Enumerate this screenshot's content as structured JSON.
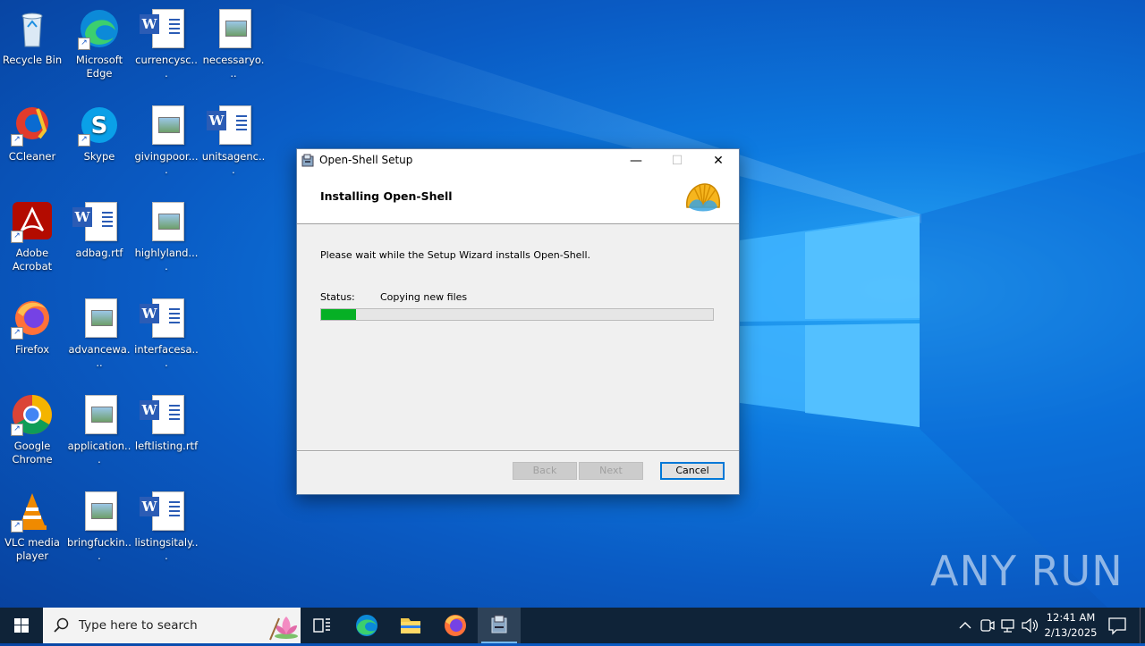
{
  "desktop": {
    "icons": [
      {
        "label": "Recycle Bin"
      },
      {
        "label": "Microsoft Edge"
      },
      {
        "label": "currencysc..."
      },
      {
        "label": "necessaryo..."
      },
      {
        "label": "CCleaner"
      },
      {
        "label": "Skype"
      },
      {
        "label": "givingpoor...."
      },
      {
        "label": "unitsagenc..."
      },
      {
        "label": "Adobe Acrobat"
      },
      {
        "label": "adbag.rtf"
      },
      {
        "label": "highlyland...."
      },
      {
        "label": "Firefox"
      },
      {
        "label": "advancewa..."
      },
      {
        "label": "interfacesa..."
      },
      {
        "label": "Google Chrome"
      },
      {
        "label": "application..."
      },
      {
        "label": "leftlisting.rtf"
      },
      {
        "label": "VLC media player"
      },
      {
        "label": "bringfuckin..."
      },
      {
        "label": "listingsitaly..."
      }
    ]
  },
  "dialog": {
    "title": "Open-Shell Setup",
    "heading": "Installing Open-Shell",
    "message": "Please wait while the Setup Wizard installs Open-Shell.",
    "status_label": "Status:",
    "status_value": "Copying new files",
    "progress_fraction": 0.09,
    "buttons": {
      "back": "Back",
      "next": "Next",
      "cancel": "Cancel"
    }
  },
  "watermark": "ANY RUN",
  "taskbar": {
    "search_placeholder": "Type here to search",
    "pinned": [
      "task-view-icon",
      "edge-icon",
      "file-explorer-icon",
      "firefox-icon",
      "setup-icon"
    ],
    "clock": {
      "time": "12:41 AM",
      "date": "2/13/2025"
    }
  },
  "colors": {
    "progress_fill": "#06b025",
    "taskbar": "#0f2338",
    "accent": "#0078d7"
  }
}
